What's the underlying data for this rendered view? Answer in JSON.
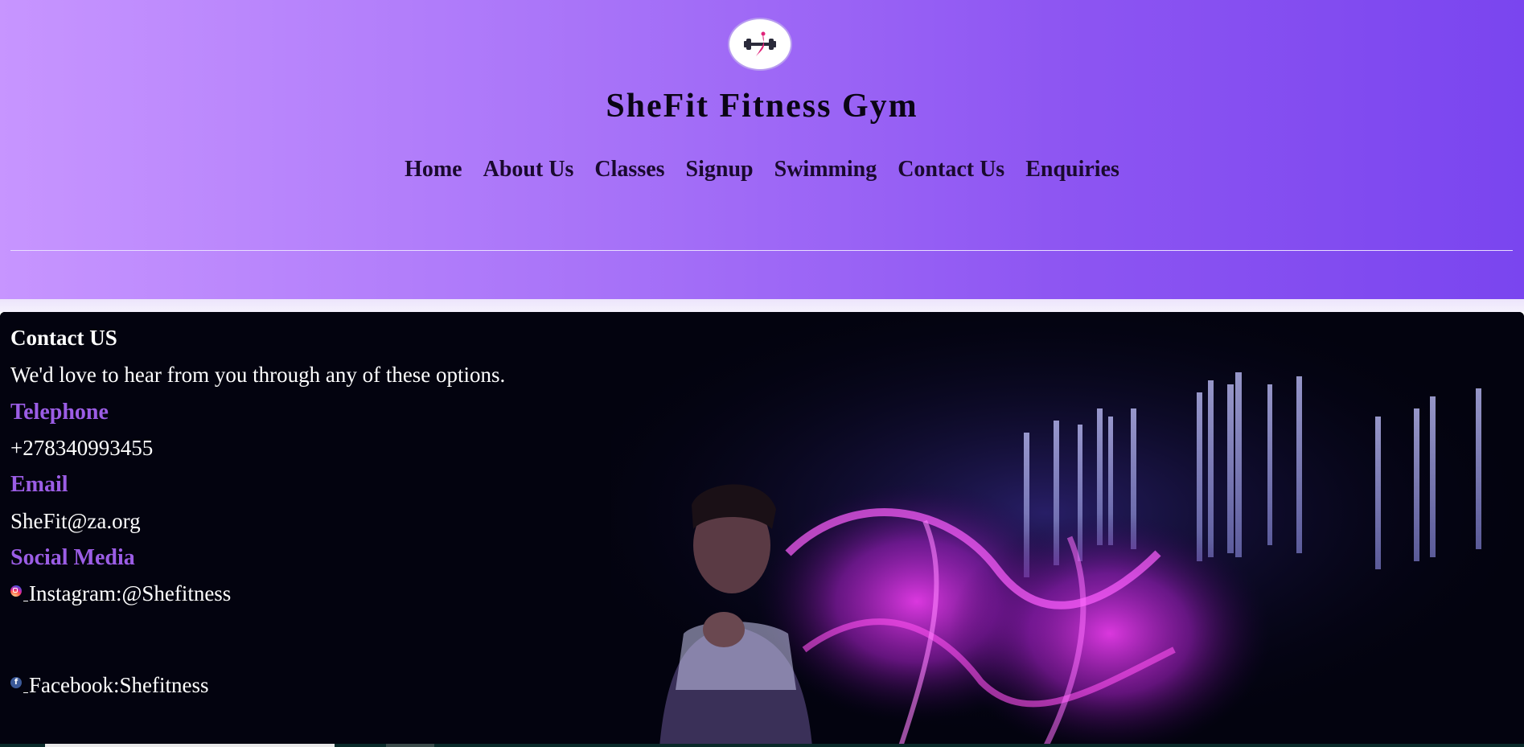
{
  "header": {
    "logo_icon": "dumbbell-woman-icon",
    "title": "SheFit Fitness Gym",
    "nav": [
      {
        "label": "Home"
      },
      {
        "label": "About Us"
      },
      {
        "label": "Classes"
      },
      {
        "label": "Signup"
      },
      {
        "label": "Swimming"
      },
      {
        "label": "Contact Us"
      },
      {
        "label": "Enquiries"
      }
    ]
  },
  "contact": {
    "heading": "Contact US",
    "intro": "We'd love to hear from you through any of these options.",
    "telephone_label": "Telephone",
    "telephone": "+278340993455",
    "email_label": "Email",
    "email": "SheFit@za.org",
    "social_label": "Social Media",
    "instagram": "Instagram:@Shefitness",
    "facebook": "Facebook:Shefitness"
  },
  "colors": {
    "header_gradient_start": "#c795ff",
    "header_gradient_end": "#7a45ef",
    "label_purple": "#9b5de5",
    "section_bg": "#03030f"
  }
}
